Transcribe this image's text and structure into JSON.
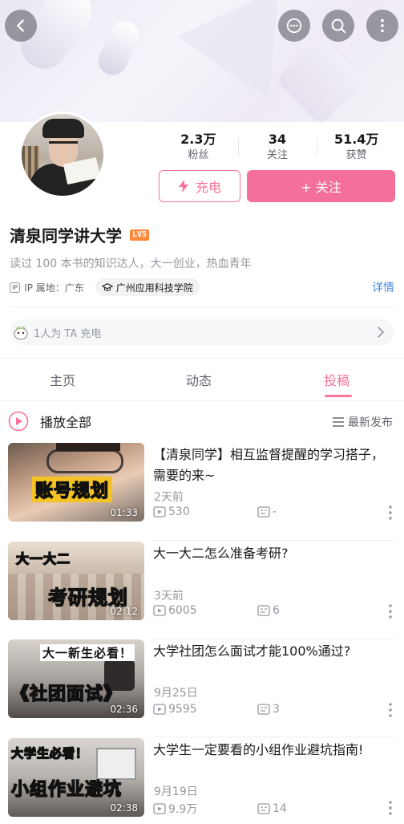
{
  "header": {
    "back_icon": "chevron-left-icon",
    "message_icon": "chat-bubble-icon",
    "search_icon": "search-icon",
    "more_icon": "vertical-dots-icon"
  },
  "profile": {
    "stats": [
      {
        "num": "2.3万",
        "label": "粉丝"
      },
      {
        "num": "34",
        "label": "关注"
      },
      {
        "num": "51.4万",
        "label": "获赞"
      }
    ],
    "charge_label": "充电",
    "follow_label": "+ 关注",
    "name": "清泉同学讲大学",
    "level": "LV5",
    "bio": "读过 100 本书的知识达人，大一创业，热血青年",
    "ip_tag": "IP",
    "ip_location": "IP 属地：广东",
    "school": "广州应用科技学院",
    "detail_link": "详情",
    "charge_bar_text": "1人为 TA 充电"
  },
  "tabs": [
    {
      "label": "主页"
    },
    {
      "label": "动态"
    },
    {
      "label": "投稿"
    }
  ],
  "list_header": {
    "play_all": "播放全部",
    "sort": "最新发布"
  },
  "accent_color": "#fb7299",
  "videos": [
    {
      "title": "【清泉同学】相互监督提醒的学习搭子，需要的来~",
      "caption": "账号规划",
      "duration": "01:33",
      "date": "2天前",
      "views": "530",
      "danmaku": "-"
    },
    {
      "title": "大一大二怎么准备考研?",
      "caption": "考研规划",
      "caption_top": "大一大二",
      "duration": "02:12",
      "date": "3天前",
      "views": "6005",
      "danmaku": "6"
    },
    {
      "title": "大学社团怎么面试才能100%通过?",
      "caption": "《社团面试》",
      "caption_top": "大一新生必看！",
      "duration": "02:36",
      "date": "9月25日",
      "views": "9595",
      "danmaku": "3"
    },
    {
      "title": "大学生一定要看的小组作业避坑指南!",
      "caption": "小组作业避坑",
      "caption_top": "大学生必看！",
      "duration": "02:38",
      "date": "9月19日",
      "views": "9.9万",
      "danmaku": "14"
    }
  ]
}
